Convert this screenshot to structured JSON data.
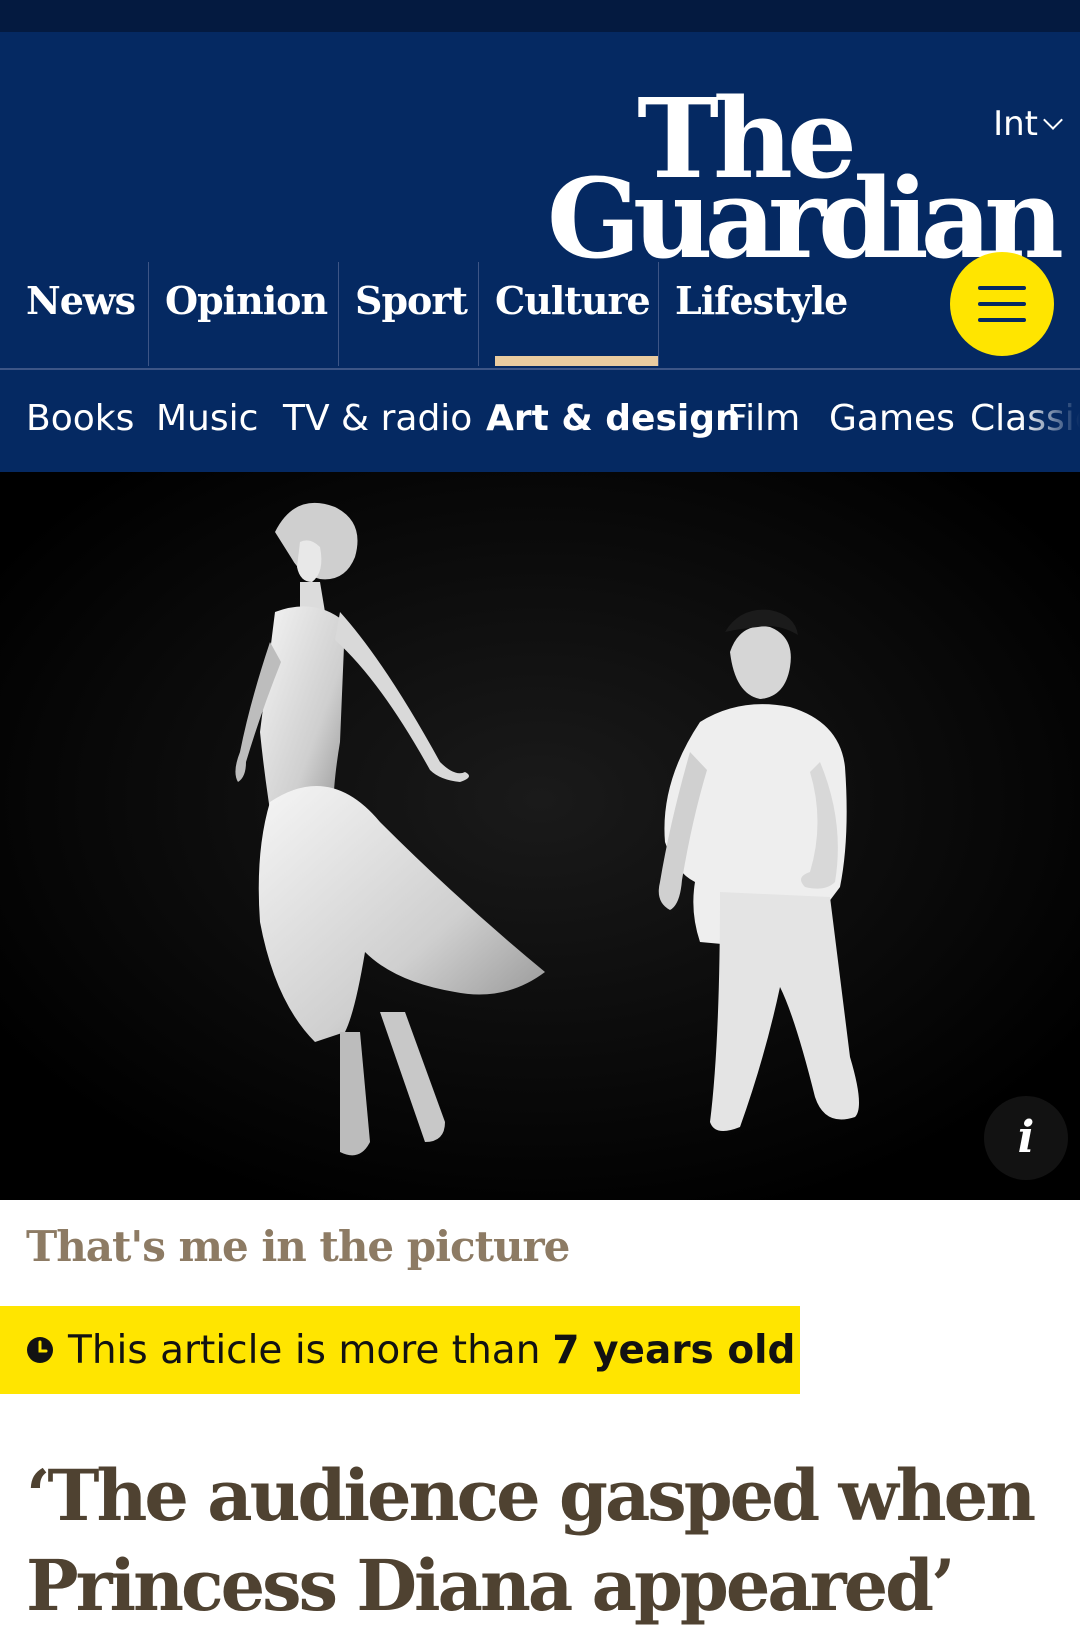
{
  "masthead": {
    "logo_line1": "The",
    "logo_line2": "Guardian",
    "edition": "Int"
  },
  "nav": {
    "pillars": [
      "News",
      "Opinion",
      "Sport",
      "Culture",
      "Lifestyle"
    ],
    "active_pillar": "Culture",
    "menu_icon": "hamburger-icon",
    "subnav": [
      "Books",
      "Music",
      "TV & radio",
      "Art & design",
      "Film",
      "Games",
      "Classic"
    ],
    "active_subnav": "Art & design"
  },
  "hero": {
    "info_label": "i"
  },
  "article": {
    "series": "That's me in the picture",
    "age_prefix": "This article is more than",
    "age_value": "7 years old",
    "headline": "‘The audience gasped when Princess Diana appeared’"
  },
  "colors": {
    "brand_blue": "#052962",
    "highlight_yellow": "#ffe500",
    "culture_accent": "#eacca0",
    "culture_text": "#4f4231"
  }
}
